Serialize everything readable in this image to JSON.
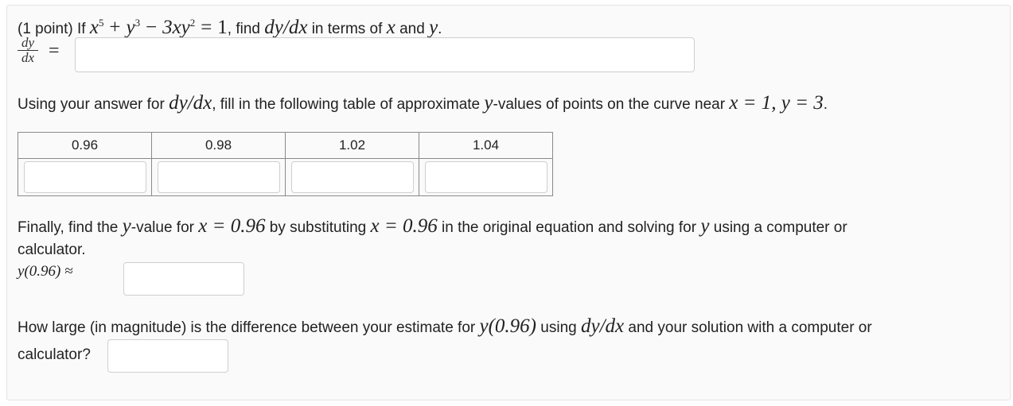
{
  "question": {
    "points": "(1 point)",
    "if_word": "If",
    "equation": {
      "x": "x",
      "x_exp": "5",
      "plus": "+",
      "y": "y",
      "y_exp": "3",
      "minus": "−",
      "term3": "3xy",
      "term3_exp": "2",
      "equals": "=",
      "rhs": "1"
    },
    "find_text": ", find",
    "deriv": "dy/dx",
    "in_terms_of": "in terms of",
    "var_x": "x",
    "and_word": "and",
    "var_y": "y",
    "period": "."
  },
  "answer_label": {
    "num": "dy",
    "den": "dx",
    "equals": "="
  },
  "part2": {
    "text_before": "Using your answer for",
    "deriv": "dy/dx",
    "text_mid": ", fill in the following table of approximate",
    "var_y": "y",
    "text_after": "-values of points on the curve near",
    "point": "x = 1, y = 3",
    "period": "."
  },
  "table": {
    "headers": [
      "0.96",
      "0.98",
      "1.02",
      "1.04"
    ]
  },
  "part3": {
    "text1": "Finally, find the",
    "var_y": "y",
    "text2": "-value for",
    "xeq1": "x = 0.96",
    "text3": "by substituting",
    "xeq2": "x = 0.96",
    "text4": "in the original equation and solving for",
    "var_y2": "y",
    "text5": "using a computer or",
    "line2": "calculator.",
    "label": "y(0.96) ≈"
  },
  "part4": {
    "text1": "How large (in magnitude) is the difference between your estimate for",
    "expr": "y(0.96)",
    "text2": "using",
    "deriv": "dy/dx",
    "text3": "and your solution with a computer or",
    "line2": "calculator?"
  }
}
